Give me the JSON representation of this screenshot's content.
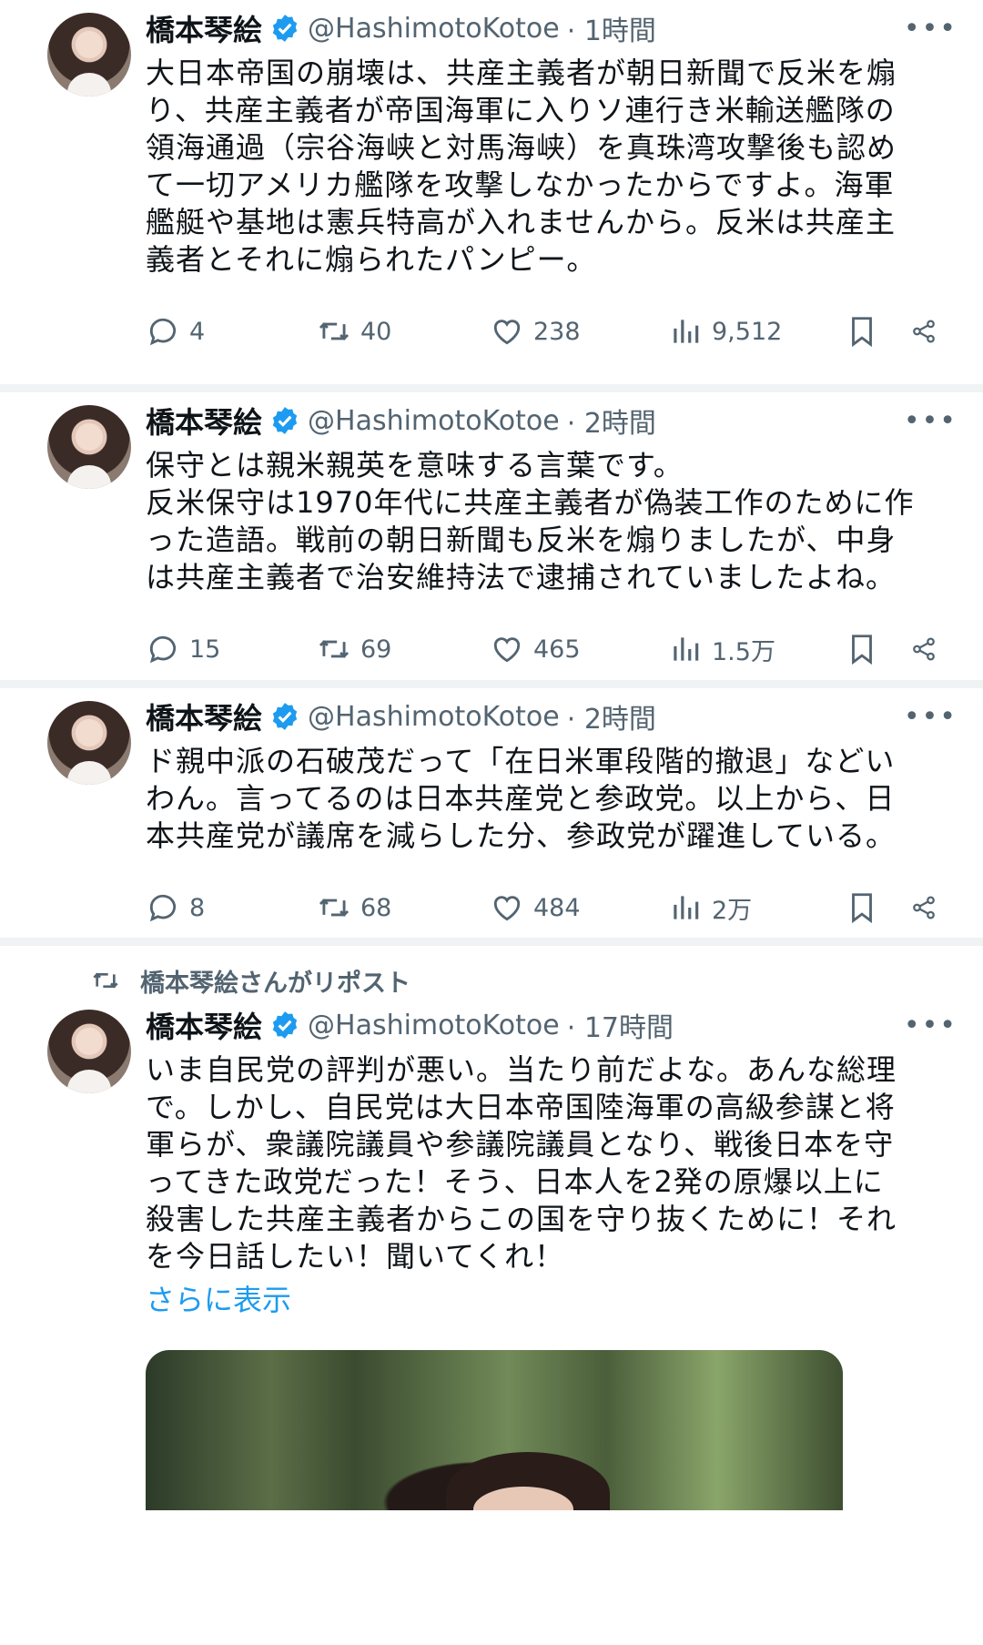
{
  "tweets": [
    {
      "name": "橋本琴絵",
      "handle": "@HashimotoKotoe",
      "time": "· 1時間",
      "more": "•••",
      "lines": [
        "大日本帝国の崩壊は、共産主義者が朝日新聞で反米を煽",
        "り、共産主義者が帝国海軍に入りソ連行き米輸送艦隊の",
        "領海通過（宗谷海峡と対馬海峡）を真珠湾攻撃後も認め",
        "て一切アメリカ艦隊を攻撃しなかったからですよ。海軍",
        "艦艇や基地は憲兵特高が入れませんから。反米は共産主",
        "義者とそれに煽られたパンピー。"
      ],
      "replies": "4",
      "reposts": "40",
      "likes": "238",
      "views": "9,512"
    },
    {
      "name": "橋本琴絵",
      "handle": "@HashimotoKotoe",
      "time": "· 2時間",
      "more": "•••",
      "lines": [
        "保守とは親米親英を意味する言葉です。",
        "反米保守は1970年代に共産主義者が偽装工作のために作",
        "った造語。戦前の朝日新聞も反米を煽りましたが、中身",
        "は共産主義者で治安維持法で逮捕されていましたよね。"
      ],
      "replies": "15",
      "reposts": "69",
      "likes": "465",
      "views": "1.5万"
    },
    {
      "name": "橋本琴絵",
      "handle": "@HashimotoKotoe",
      "time": "· 2時間",
      "more": "•••",
      "lines": [
        "ド親中派の石破茂だって「在日米軍段階的撤退」などい",
        "わん。言ってるのは日本共産党と参政党。以上から、日",
        "本共産党が議席を減らした分、参政党が躍進している。"
      ],
      "replies": "8",
      "reposts": "68",
      "likes": "484",
      "views": "2万"
    },
    {
      "repost_label": "橋本琴絵さんがリポスト",
      "name": "橋本琴絵",
      "handle": "@HashimotoKotoe",
      "time": "· 17時間",
      "more": "•••",
      "lines": [
        "いま自民党の評判が悪い。当たり前だよな。あんな総理",
        "で。しかし、自民党は大日本帝国陸海軍の高級参謀と将",
        "軍らが、衆議院議員や参議院議員となり、戦後日本を守",
        "ってきた政党だった！そう、日本人を2発の原爆以上に",
        "殺害した共産主義者からこの国を守り抜くために！それ",
        "を今日話したい！聞いてくれ！"
      ],
      "show_more": "さらに表示"
    }
  ],
  "colors": {
    "text": "#0f1419",
    "secondary": "#536471",
    "link": "#1d9bf0",
    "verified": "#1d9bf0",
    "separator": "#eff3f4"
  }
}
